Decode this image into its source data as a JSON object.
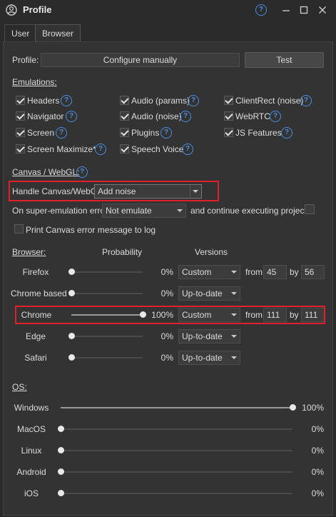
{
  "window": {
    "title": "Profile"
  },
  "tabs": [
    "User",
    "Browser"
  ],
  "profile": {
    "label": "Profile:",
    "value": "Configure manually",
    "test_button": "Test"
  },
  "emulations": {
    "heading": "Emulations:",
    "items": [
      {
        "label": "Headers",
        "checked": true
      },
      {
        "label": "Navigator",
        "checked": true
      },
      {
        "label": "Screen",
        "checked": true
      },
      {
        "label": "Screen Maximize*",
        "checked": true
      },
      {
        "label": "Audio (params)",
        "checked": true
      },
      {
        "label": "Audio (noise)",
        "checked": true
      },
      {
        "label": "Plugins",
        "checked": true
      },
      {
        "label": "Speech Voice",
        "checked": true
      },
      {
        "label": "ClientRect (noise)",
        "checked": true
      },
      {
        "label": "WebRTC",
        "checked": true
      },
      {
        "label": "JS Features",
        "checked": true
      }
    ]
  },
  "canvas": {
    "heading": "Canvas / WebGL:",
    "handle_label": "Handle Canvas/WebGL",
    "handle_value": "Add noise",
    "error_label": "On super-emulation error",
    "error_value": "Not emulate",
    "continue_label": "and continue executing project",
    "print_label": "Print Canvas error message to log"
  },
  "browser": {
    "heading": "Browser:",
    "col_probability": "Probability",
    "col_versions": "Versions",
    "from_label": "from",
    "by_label": "by",
    "rows": [
      {
        "name": "Firefox",
        "percent": "0%",
        "probability": 0,
        "version_mode": "Custom",
        "from": "45",
        "by": "56"
      },
      {
        "name": "Chrome based",
        "percent": "0%",
        "probability": 0,
        "version_mode": "Up-to-date"
      },
      {
        "name": "Chrome",
        "percent": "100%",
        "probability": 100,
        "version_mode": "Custom",
        "from": "111",
        "by": "111"
      },
      {
        "name": "Edge",
        "percent": "0%",
        "probability": 0,
        "version_mode": "Up-to-date"
      },
      {
        "name": "Safari",
        "percent": "0%",
        "probability": 0,
        "version_mode": "Up-to-date"
      }
    ]
  },
  "os": {
    "heading": "OS:",
    "rows": [
      {
        "name": "Windows",
        "percent": "100%",
        "probability": 100
      },
      {
        "name": "MacOS",
        "percent": "0%",
        "probability": 0
      },
      {
        "name": "Linux",
        "percent": "0%",
        "probability": 0
      },
      {
        "name": "Android",
        "percent": "0%",
        "probability": 0
      },
      {
        "name": "iOS",
        "percent": "0%",
        "probability": 0
      }
    ]
  },
  "colors": {
    "highlight": "#e0202a",
    "help": "#4a8fe0"
  }
}
